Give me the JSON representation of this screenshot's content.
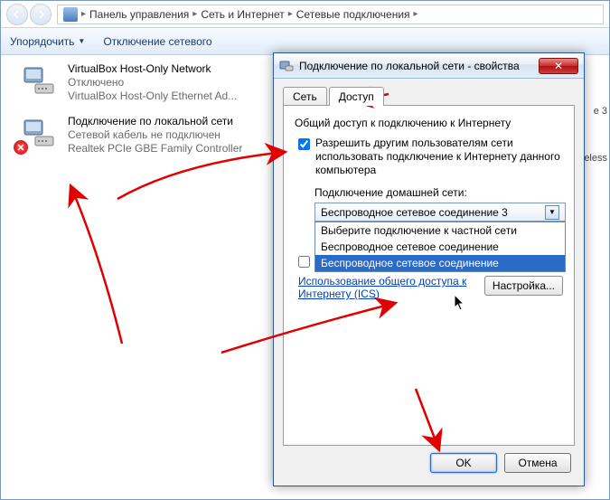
{
  "breadcrumb": {
    "part1": "Панель управления",
    "part2": "Сеть и Интернет",
    "part3": "Сетевые подключения"
  },
  "toolbar": {
    "organize": "Упорядочить",
    "disable": "Отключение сетевого"
  },
  "connections": [
    {
      "name": "VirtualBox Host-Only Network",
      "status": "Отключено",
      "adapter": "VirtualBox Host-Only Ethernet Ad..."
    },
    {
      "name": "Подключение по локальной сети",
      "status": "Сетевой кабель не подключен",
      "adapter": "Realtek PCIe GBE Family Controller"
    }
  ],
  "right_hints": {
    "line1": "е 3",
    "line2": "reless"
  },
  "dialog": {
    "title": "Подключение по локальной сети - свойства",
    "tabs": {
      "net": "Сеть",
      "access": "Доступ"
    },
    "group": "Общий доступ к подключению к Интернету",
    "check1": "Разрешить другим пользователям сети использовать подключение к Интернету данного компьютера",
    "home_label": "Подключение домашней сети:",
    "selected": "Беспроводное сетевое соединение 3",
    "options": {
      "o1": "Выберите подключение к частной сети",
      "o2": "Беспроводное сетевое соединение",
      "o3": "Беспроводное сетевое соединение"
    },
    "link": "Использование общего доступа к Интернету (ICS)",
    "settings": "Настройка...",
    "ok": "OK",
    "cancel": "Отмена"
  }
}
